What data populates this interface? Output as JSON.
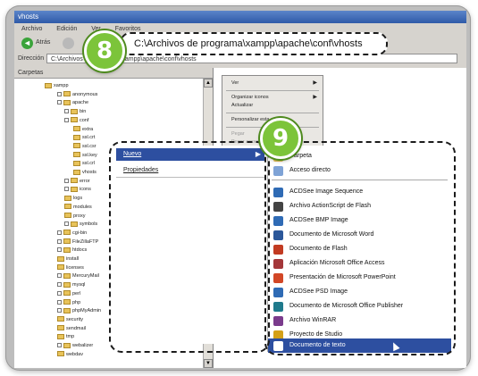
{
  "window": {
    "title": "vhosts",
    "menus": [
      "Archivo",
      "Edición",
      "Ver",
      "Favoritos"
    ],
    "back_label": "Atrás",
    "address_label": "Dirección",
    "address_value": "C:\\Archivos de programa\\xampp\\apache\\conf\\vhosts"
  },
  "left_pane": {
    "title": "Carpetas",
    "tree": [
      "xampp",
      "anonymous",
      "apache",
      "bin",
      "conf",
      "extra",
      "ssl.crt",
      "ssl.csr",
      "ssl.key",
      "ssl.crl",
      "vhosts",
      "error",
      "icons",
      "logs",
      "modules",
      "proxy",
      "symbols",
      "cgi-bin",
      "FileZillaFTP",
      "htdocs",
      "install",
      "licenses",
      "MercuryMail",
      "mysql",
      "perl",
      "php",
      "phpMyAdmin",
      "security",
      "sendmail",
      "tmp",
      "webalizer",
      "webdav"
    ]
  },
  "context_small": {
    "items": [
      "Ver",
      "Organizar iconos",
      "Actualizar",
      "Personalizar esta carpeta...",
      "Pegar",
      "Pegar acceso directo",
      "Nuevo",
      "Propiedades"
    ]
  },
  "menu1": {
    "nuevo": "Nuevo",
    "propiedades": "Propiedades"
  },
  "menu2": {
    "items": [
      {
        "label": "Carpeta",
        "color": "#e8c35a"
      },
      {
        "label": "Acceso directo",
        "color": "#7fa3d6"
      },
      {
        "label": "ACDSee Image Sequence",
        "color": "#2f6bb5"
      },
      {
        "label": "Archivo ActionScript de Flash",
        "color": "#444444"
      },
      {
        "label": "ACDSee BMP Image",
        "color": "#2f6bb5"
      },
      {
        "label": "Documento de Microsoft Word",
        "color": "#2b579a"
      },
      {
        "label": "Documento de Flash",
        "color": "#c23b22"
      },
      {
        "label": "Aplicación Microsoft Office Access",
        "color": "#a4373a"
      },
      {
        "label": "Presentación de Microsoft PowerPoint",
        "color": "#d24726"
      },
      {
        "label": "ACDSee PSD Image",
        "color": "#2f6bb5"
      },
      {
        "label": "Documento de Microsoft Office Publisher",
        "color": "#1f7a8c"
      },
      {
        "label": "Archivo WinRAR",
        "color": "#7a3b8c"
      },
      {
        "label": "Proyecto de Studio",
        "color": "#d4a017"
      },
      {
        "label": "Documento de texto",
        "color": "#ffffff"
      }
    ]
  },
  "callouts": {
    "step8": "8",
    "step9": "9"
  },
  "colors": {
    "badge_green": "#7cc43a",
    "selection_blue": "#2d4fa0"
  }
}
